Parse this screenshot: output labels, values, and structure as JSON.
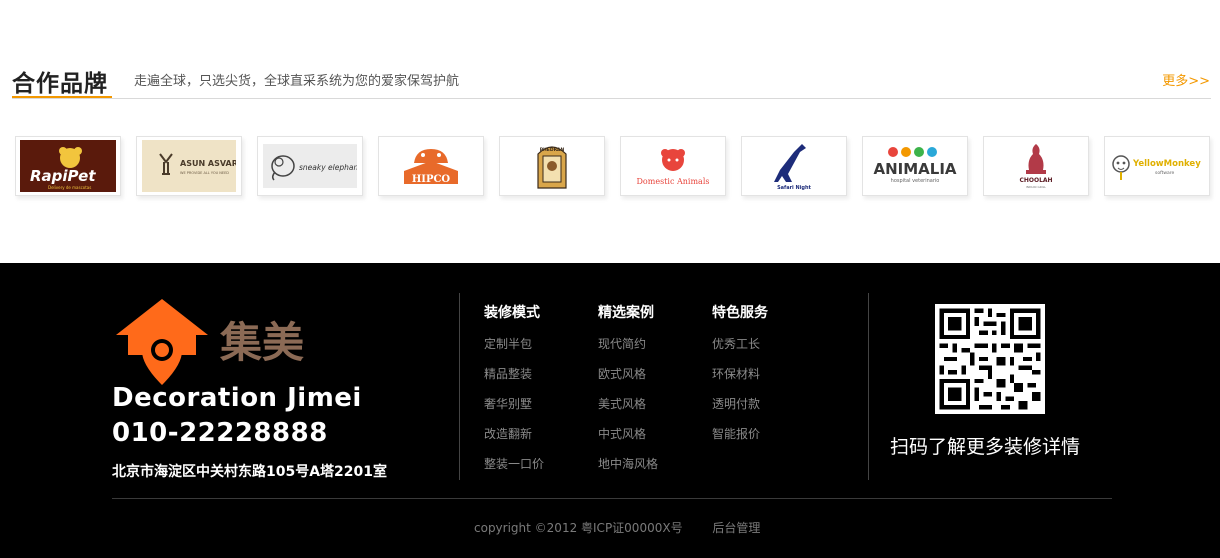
{
  "partners": {
    "title": "合作品牌",
    "subtitle": "走遍全球，只选尖货，全球直采系统为您的爱家保驾护航",
    "more": "更多>>",
    "logos": [
      {
        "name": "RapiPet",
        "sub": "Delivery de mascotas"
      },
      {
        "name": "ASUN ASVAR",
        "sub": "WE PROVIDE ALL YOU NEED"
      },
      {
        "name": "sneaky elephant"
      },
      {
        "name": "HIPCO"
      },
      {
        "name": "PHEDRAN"
      },
      {
        "name": "Domestic Animals"
      },
      {
        "name": "Safari Night"
      },
      {
        "name": "ANIMALIA",
        "sub": "hospital veterinario"
      },
      {
        "name": "CHOOLAH",
        "sub": "INDIAN GRILL"
      },
      {
        "name": "YellowMonkey",
        "sub": "software"
      }
    ]
  },
  "footer": {
    "brand_glyphs": "集美",
    "brand_name": "Decoration Jimei",
    "phone": "010-22228888",
    "address": "北京市海淀区中关村东路105号A塔2201室",
    "columns": [
      {
        "title": "装修模式",
        "links": [
          "定制半包",
          "精品整装",
          "奢华别墅",
          "改造翻新",
          "整装一口价"
        ]
      },
      {
        "title": "精选案例",
        "links": [
          "现代简约",
          "欧式风格",
          "美式风格",
          "中式风格",
          "地中海风格"
        ]
      },
      {
        "title": "特色服务",
        "links": [
          "优秀工长",
          "环保材料",
          "透明付款",
          "智能报价"
        ]
      }
    ],
    "qr_text": "扫码了解更多装修详情",
    "copyright": "copyright ©2012 粤ICP证00000X号",
    "admin": "后台管理"
  },
  "colors": {
    "accent": "#f39800",
    "brand_orange": "#ff6a1a",
    "footer_bg": "#000000"
  }
}
